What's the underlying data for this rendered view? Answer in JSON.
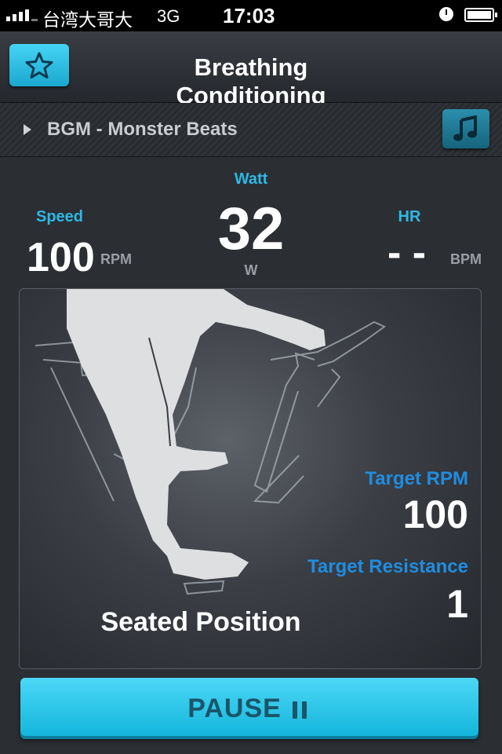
{
  "status_bar": {
    "carrier": "台湾大哥大",
    "network": "3G",
    "time": "17:03"
  },
  "header": {
    "title": "Breathing Conditioning",
    "favorite_icon": "star-icon"
  },
  "bgm": {
    "label": "BGM - Monster Beats",
    "music_icon": "music-note-icon"
  },
  "metrics": {
    "speed": {
      "label": "Speed",
      "value": "100",
      "unit": "RPM"
    },
    "watt": {
      "label": "Watt",
      "value": "32",
      "unit": "W"
    },
    "hr": {
      "label": "HR",
      "value": "- -",
      "unit": "BPM"
    }
  },
  "panel": {
    "position": "Seated Position",
    "target_rpm_label": "Target RPM",
    "target_rpm_value": "100",
    "target_resistance_label": "Target Resistance",
    "target_resistance_value": "1"
  },
  "controls": {
    "pause_label": "PAUSE"
  },
  "colors": {
    "accent": "#2fb8e4",
    "target_blue": "#1f8de0",
    "button": "#22c4e8"
  }
}
